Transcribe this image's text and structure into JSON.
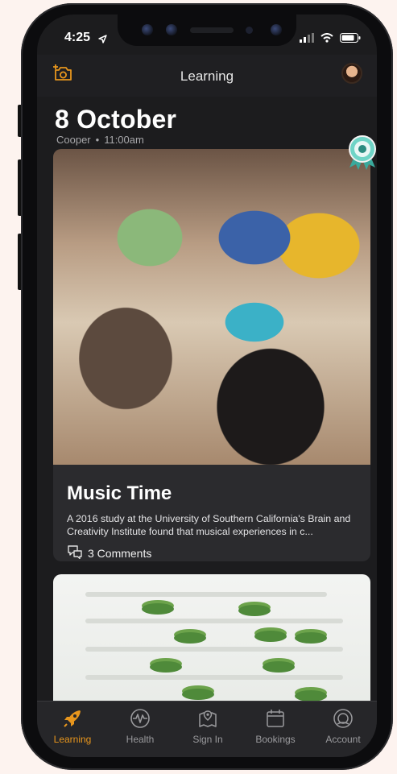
{
  "status": {
    "time": "4:25"
  },
  "nav": {
    "title": "Learning"
  },
  "post": {
    "date": "8 October",
    "author": "Cooper",
    "time": "11:00am",
    "title": "Music Time",
    "description": "A 2016 study at the University of Southern California's Brain and Creativity Institute found that musical experiences in c...",
    "comments": "3 Comments"
  },
  "tabs": [
    {
      "label": "Learning",
      "icon": "rocket-icon",
      "active": true
    },
    {
      "label": "Health",
      "icon": "heart-pulse-icon",
      "active": false
    },
    {
      "label": "Sign In",
      "icon": "map-pin-icon",
      "active": false
    },
    {
      "label": "Bookings",
      "icon": "calendar-icon",
      "active": false
    },
    {
      "label": "Account",
      "icon": "account-icon",
      "active": false
    }
  ],
  "colors": {
    "accent": "#e8961d",
    "background": "#1c1c1e",
    "card": "#2b2b2e"
  }
}
